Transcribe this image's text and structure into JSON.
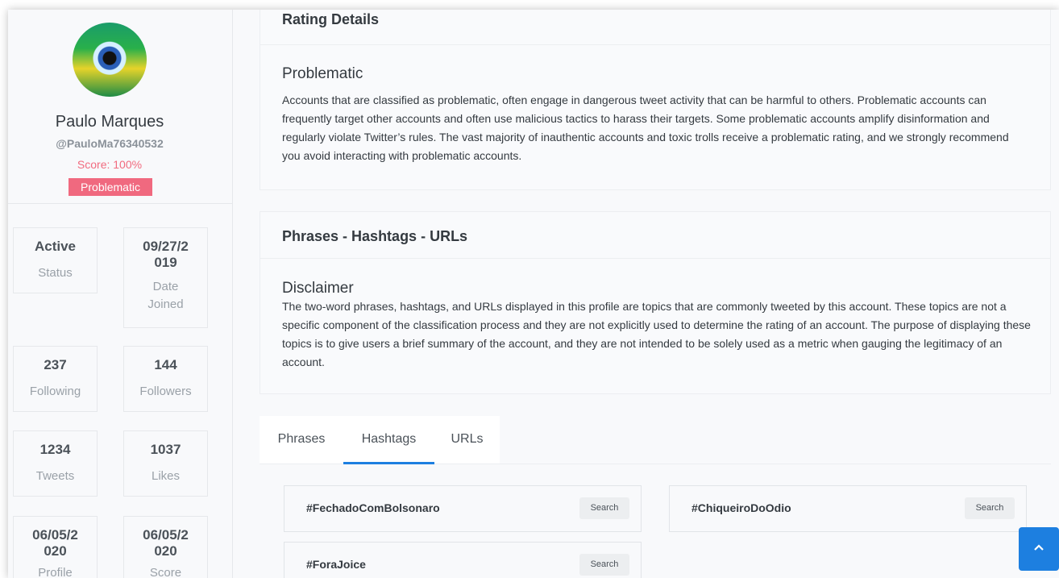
{
  "profile": {
    "name": "Paulo Marques",
    "handle": "@PauloMa76340532",
    "score": "Score: 100%",
    "badge": "Problematic"
  },
  "stats": [
    {
      "value": "Active",
      "label": "Status"
    },
    {
      "value": "09/27/2\n019",
      "label": "Date\nJoined"
    },
    {
      "value": "237",
      "label": "Following"
    },
    {
      "value": "144",
      "label": "Followers"
    },
    {
      "value": "1234",
      "label": "Tweets"
    },
    {
      "value": "1037",
      "label": "Likes"
    },
    {
      "value": "06/05/2\n020",
      "label": "Profile"
    },
    {
      "value": "06/05/2\n020",
      "label": "Score"
    }
  ],
  "rating": {
    "title": "Rating Details",
    "subtitle": "Problematic",
    "description": "Accounts that are classified as problematic, often engage in dangerous tweet activity that can be harmful to others. Problematic accounts can frequently target other accounts and often use malicious tactics to harass their targets. Some problematic accounts amplify disinformation and regularly violate Twitter’s rules. The vast majority of inauthentic accounts and toxic trolls receive a problematic rating, and we strongly recommend you avoid interacting with problematic accounts."
  },
  "phrases": {
    "title": "Phrases - Hashtags - URLs",
    "disclaimer_title": "Disclaimer",
    "disclaimer_text": "The two-word phrases, hashtags, and URLs displayed in this profile are topics that are commonly tweeted by this account. These topics are not a specific component of the classification process and they are not explicitly used to determine the rating of an account. The purpose of displaying these topics is to give users a brief summary of the account, and they are not intended to be solely used as a metric when gauging the legitimacy of an account."
  },
  "tabs": {
    "phrases": "Phrases",
    "hashtags": "Hashtags",
    "urls": "URLs",
    "active": "Hashtags"
  },
  "hashtags": [
    {
      "tag": "#FechadoComBolsonaro",
      "button": "Search"
    },
    {
      "tag": "#ChiqueiroDoOdio",
      "button": "Search"
    },
    {
      "tag": "#ForaJoice",
      "button": "Search"
    }
  ],
  "colors": {
    "accent": "#1d7fe0",
    "problematic": "#f0697f"
  },
  "icons": {
    "scroll_top": "chevron-up-icon"
  }
}
